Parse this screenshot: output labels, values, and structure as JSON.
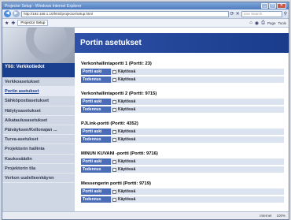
{
  "window": {
    "title": "Projector Setup - Windows Internet Explorer"
  },
  "address": {
    "url": "http://192.168.1.10/html/projector/setup.html",
    "search_placeholder": "Live Search"
  },
  "favbar": {
    "tab_label": "Projector Setup",
    "tools": [
      "Page",
      "Tools"
    ]
  },
  "sidebar": {
    "heading": "Yliö: Verkkotiedot",
    "items": [
      {
        "label": "Verkkoasetukset"
      },
      {
        "label": "Portin asetukset",
        "active": true
      },
      {
        "label": "Sähköpostiasetukset"
      },
      {
        "label": "Hälytysasetukset"
      },
      {
        "label": "Aikataulusasetukset"
      },
      {
        "label": "Päiväyksen/Kellonajan ..."
      },
      {
        "label": "Turva-asetukset"
      },
      {
        "label": "Projektorin hallinta"
      },
      {
        "label": "Kaukosäädin"
      },
      {
        "label": "Projektorin tila"
      },
      {
        "label": "Verkon uudelleenkäynn"
      }
    ]
  },
  "main": {
    "title": "Portin asetukset",
    "sections": [
      {
        "title": "Verkonhallintaportti 1 (Portti: 23)",
        "rows": [
          {
            "label": "Portti auki",
            "value": "Käytössä"
          },
          {
            "label": "Todennus",
            "value": "Käytössä"
          }
        ]
      },
      {
        "title": "Verkonhallintaportti 2 (Portti: 9715)",
        "rows": [
          {
            "label": "Portti auki",
            "value": "Käytössä"
          },
          {
            "label": "Todennus",
            "value": "Käytössä"
          }
        ]
      },
      {
        "title": "PJLink-portti (Portti: 4352)",
        "rows": [
          {
            "label": "Portti auki",
            "value": "Käytössä"
          },
          {
            "label": "Todennus",
            "value": "Käytössä"
          }
        ]
      },
      {
        "title": "MINUN KUVANI -portti (Portti: 9716)",
        "rows": [
          {
            "label": "Portti auki",
            "value": "Käytössä"
          },
          {
            "label": "Todennus",
            "value": "Käytössä"
          }
        ]
      },
      {
        "title": "Messengerin portti (Portti: 9719)",
        "rows": [
          {
            "label": "Portti auki",
            "value": "Käytössä"
          },
          {
            "label": "Todennus",
            "value": "Käytössä"
          }
        ]
      }
    ]
  },
  "status": {
    "left": "Internet",
    "right": "100%"
  }
}
